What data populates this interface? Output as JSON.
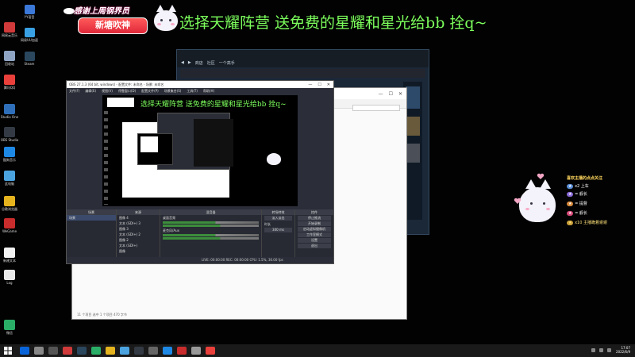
{
  "overlay": {
    "thanks_text": "感谢上周钢界员",
    "streamer_name": "新塘吹神",
    "marquee": "选择天耀阵营 送免费的星耀和星光给bb 拴q~"
  },
  "desktop_icons": [
    {
      "label": "网易云音乐",
      "color": "#d13a3a"
    },
    {
      "label": "回收站",
      "color": "#8fa4c3"
    },
    {
      "label": "腾讯QQ",
      "color": "#e9403b"
    },
    {
      "label": "Studio One",
      "color": "#2f6fba"
    },
    {
      "label": "OBS Studio",
      "color": "#333a44"
    },
    {
      "label": "酷狗音乐",
      "color": "#1e88e5"
    },
    {
      "label": "此电脑",
      "color": "#4aa3df"
    },
    {
      "label": "谷歌浏览器",
      "color": "#e5b31d"
    },
    {
      "label": "WeGame",
      "color": "#c92c2c"
    },
    {
      "label": "Log",
      "color": "#e8e8e8"
    },
    {
      "label": "新建文本",
      "color": "#f2f2f2"
    },
    {
      "label": "微信",
      "color": "#2aae67"
    }
  ],
  "desktop_icons_col2": [
    {
      "label": "YY语音",
      "color": "#3b78d8"
    },
    {
      "label": "网易UU加速器",
      "color": "#39a0e3"
    },
    {
      "label": "Steam",
      "color": "#2a475e"
    }
  ],
  "steam": {
    "nav": [
      "商店",
      "社区",
      "一个高手"
    ]
  },
  "explorer": {
    "controls": [
      "—",
      "☐",
      "✕"
    ],
    "status": "11 个项目    选中 1 个项目 470 字节"
  },
  "obs": {
    "title": "OBS 27.1.3 (64 bit, windows) - 配置文件: 未命名 - 场景: 未命名",
    "controls": [
      "—",
      "☐",
      "✕"
    ],
    "menu": [
      "文件(F)",
      "编辑(E)",
      "视图(V)",
      "停靠窗口(D)",
      "配置文件(P)",
      "场景集合(S)",
      "工具(T)",
      "帮助(H)"
    ],
    "docks": {
      "scenes": "场景",
      "sources": "来源",
      "mixer": "混音器",
      "transitions": "转场特效",
      "controls": "控件"
    },
    "scene_items": [
      "场景"
    ],
    "source_items": [
      "图像 4",
      "文本 (GDI+) 3",
      "图像 3",
      "文本 (GDI+) 2",
      "图像 2",
      "文本 (GDI+)",
      "图像"
    ],
    "mixer_items": [
      "桌面音频",
      "麦克风/Aux"
    ],
    "transition": {
      "type": "淡入淡出",
      "duration_label": "时长",
      "duration": "300 ms"
    },
    "control_buttons": [
      "停止推流",
      "开始录制",
      "启动虚拟摄像机",
      "工作室模式",
      "设置",
      "退出"
    ],
    "status": "LIVE: 00:00:00   REC: 00:00:00   CPU: 1.5%, 30.00 fps"
  },
  "follow_panel": {
    "title": "喜欢主播的点点关注",
    "lines": [
      "x2 上车",
      "= 舰长",
      "= 提督",
      "= 舰长",
      "x10 主播跪着谢谢"
    ]
  },
  "tray": {
    "time": "17:07",
    "date": "2022/6/9"
  },
  "taskbar_apps": [
    "#0a64d9",
    "#888888",
    "#555555",
    "#d13a3a",
    "#2a475e",
    "#2aae67",
    "#e5b31d",
    "#4aa3df",
    "#333a44",
    "#666666",
    "#1e88e5",
    "#c92c2c",
    "#999999",
    "#e9403b"
  ]
}
